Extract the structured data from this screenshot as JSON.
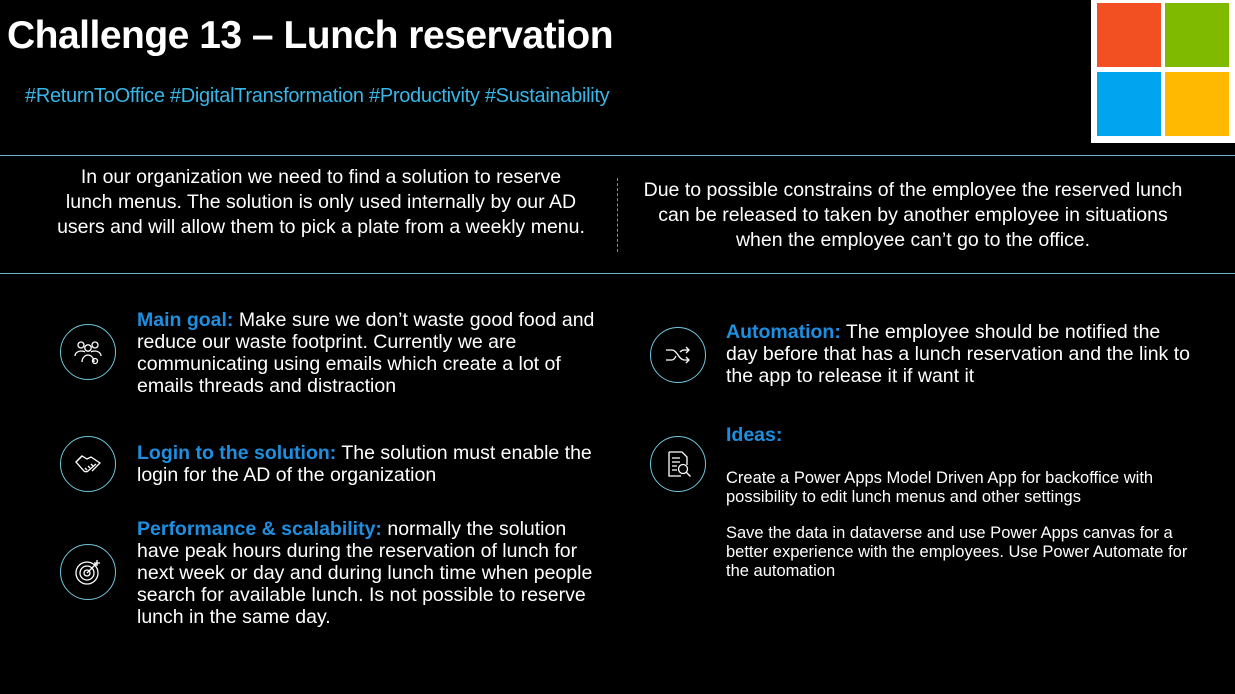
{
  "header": {
    "title": "Challenge 13 – Lunch reservation",
    "hashtags": "#ReturnToOffice #DigitalTransformation #Productivity #Sustainability"
  },
  "logo": {
    "colors": [
      "#f25022",
      "#7fba00",
      "#00a4ef",
      "#ffb900"
    ]
  },
  "intro": {
    "left": "In our organization we need to find a solution to reserve lunch menus. The solution is only used internally by our AD users and will allow them to pick a plate from a weekly menu.",
    "right": "Due to possible constrains of the employee the reserved lunch can be released to taken by another employee in situations when the employee can’t go to the office."
  },
  "items": {
    "main_goal": {
      "icon": "people-icon",
      "label": "Main goal:",
      "text": " Make sure we don’t waste good food and reduce our waste footprint. Currently we are communicating using emails which create a lot of emails threads and distraction"
    },
    "login": {
      "icon": "handshake-icon",
      "label": "Login to the solution:",
      "text": " The solution must enable the login for the AD of the organization"
    },
    "performance": {
      "icon": "target-icon",
      "label": "Performance & scalability:",
      "text": " normally the solution have peak hours during the reservation of lunch for next week or day and during lunch time when people search for available lunch. Is not possible to reserve lunch in the same day."
    },
    "automation": {
      "icon": "shuffle-icon",
      "label": "Automation:",
      "text": " The employee should be notified the day before that has a lunch reservation and the link to the app to release it if want it"
    },
    "ideas": {
      "icon": "document-search-icon",
      "label": "Ideas:",
      "text1": "Create a Power Apps Model Driven App for backoffice with possibility to edit lunch menus and other settings",
      "text2": "Save the data in dataverse and use Power Apps canvas for a better experience with the employees. Use Power Automate for the automation"
    }
  },
  "accent_colors": {
    "hashtag": "#36b7e8",
    "heading": "#1e8fe0",
    "icon_ring": "#6fc6dd"
  }
}
